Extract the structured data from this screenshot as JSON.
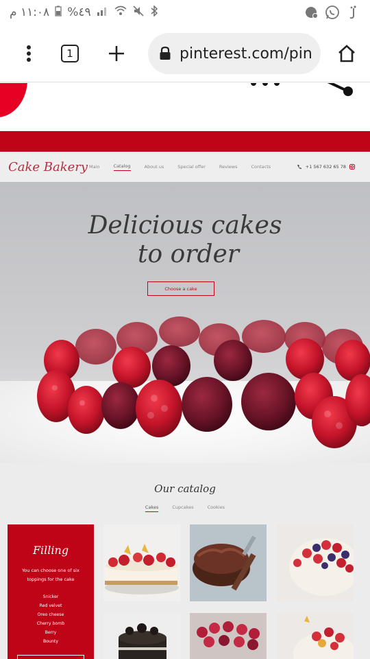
{
  "status_bar": {
    "time": "١١:٠٨ م",
    "battery": "%٤٩"
  },
  "browser": {
    "tab_count": "1",
    "url": "pinterest.com/pin"
  },
  "site": {
    "logo": "Cake Bakery",
    "nav": [
      "Main",
      "Catalog",
      "About us",
      "Special offer",
      "Reviews",
      "Contacts"
    ],
    "active_nav": "Catalog",
    "phone": "+1 567 632 65 78",
    "hero_title_line1": "Delicious cakes",
    "hero_title_line2": "to order",
    "hero_button": "Choose a cake",
    "catalog_title": "Our catalog",
    "catalog_tabs": [
      "Cakes",
      "Cupcakes",
      "Cookies"
    ],
    "filling": {
      "title": "Filling",
      "description": "You can choose one of six toppings for the cake",
      "items": [
        "Snicker",
        "Red velvet",
        "Oreo cheese",
        "Cherry bomb",
        "Berry",
        "Bounty"
      ]
    }
  },
  "colors": {
    "brand_red": "#c00418",
    "pinterest_red": "#e60023"
  }
}
